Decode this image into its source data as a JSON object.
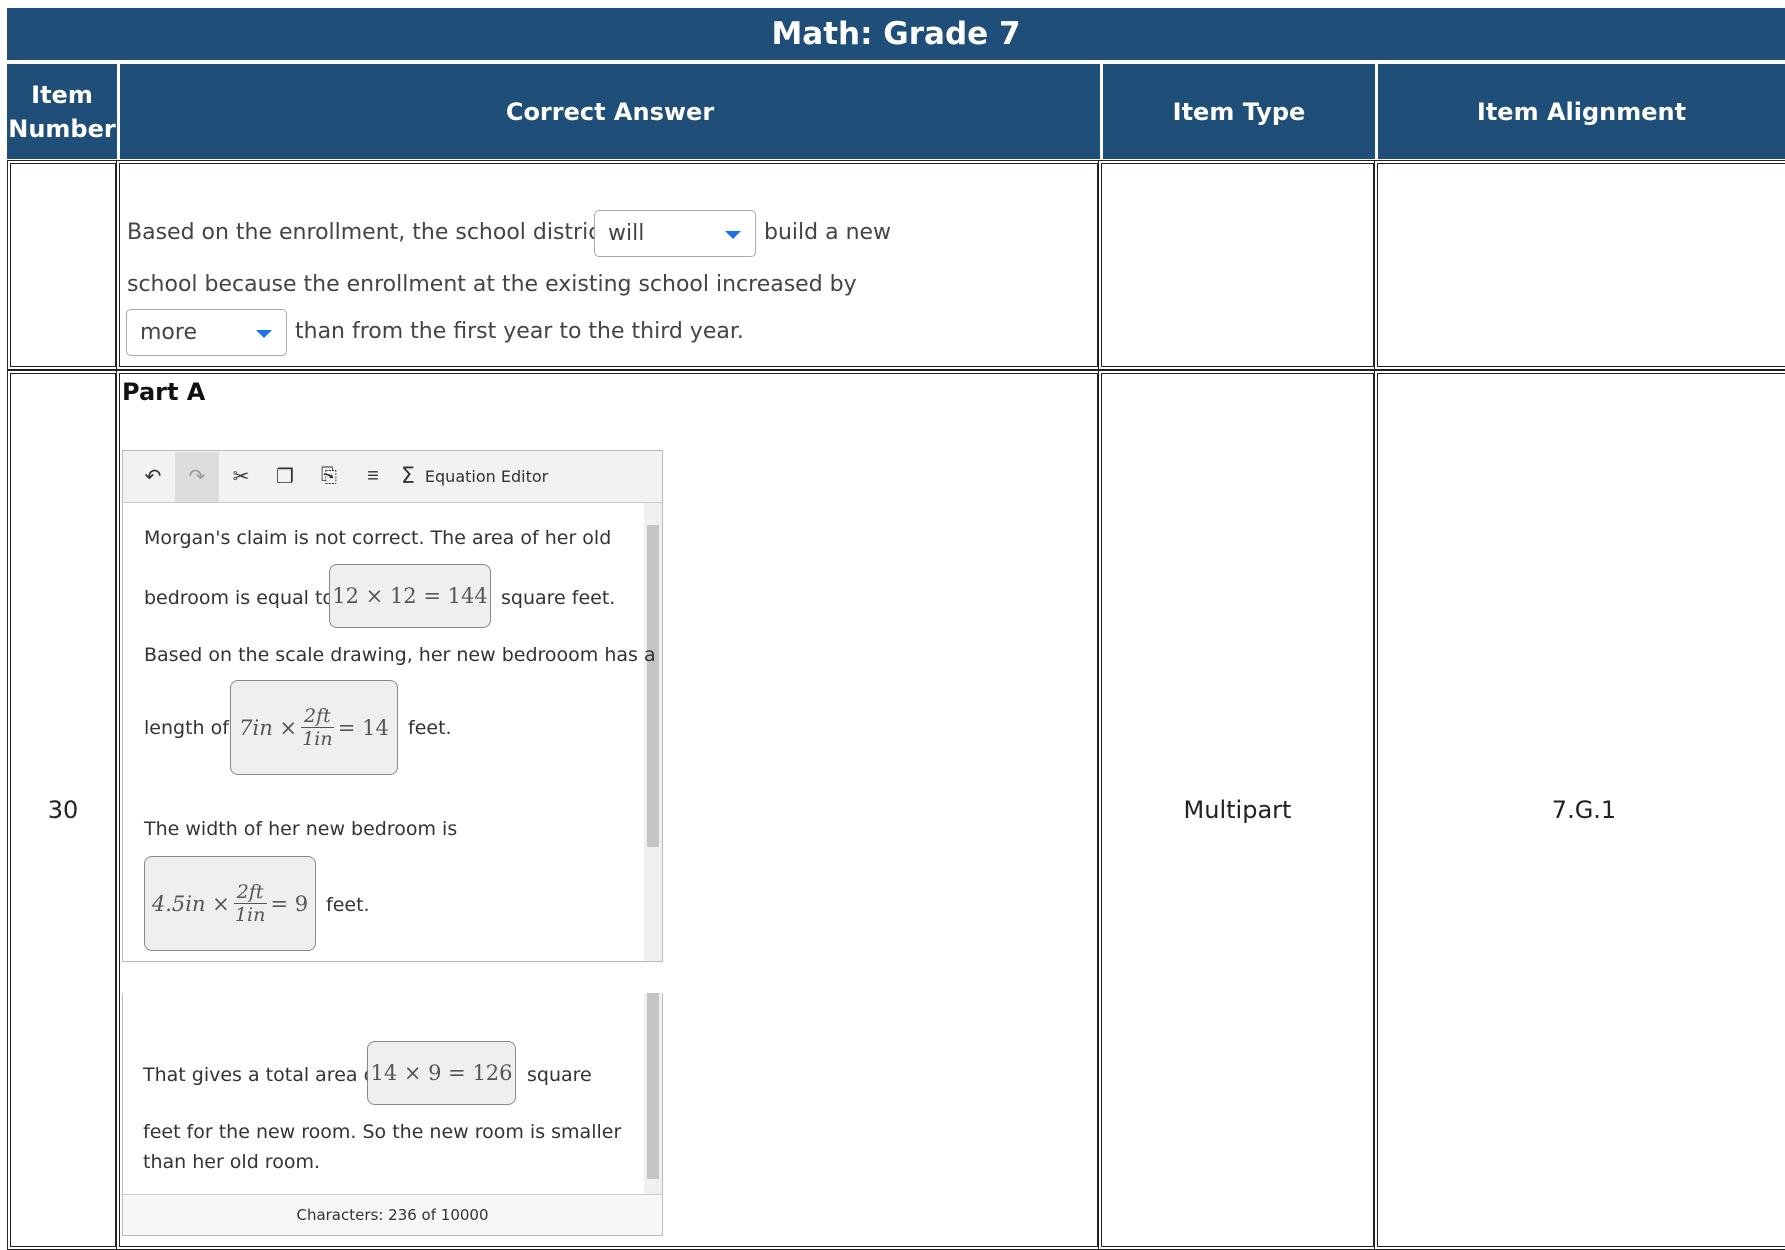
{
  "title": "Math: Grade 7",
  "headers": {
    "item_number": "Item Number",
    "correct_answer": "Correct Answer",
    "item_type": "Item Type",
    "item_alignment": "Item Alignment"
  },
  "row1": {
    "text_before_dropdown1": "Based on the enrollment, the school district",
    "dropdown1_value": "will",
    "text_after_dropdown1": "build a new",
    "text_line2": "school because the enrollment at the existing school increased by",
    "dropdown2_value": "more",
    "text_after_dropdown2": "than from the first year to the third year."
  },
  "row2": {
    "item_number": "30",
    "item_type": "Multipart",
    "item_alignment": "7.G.1",
    "part_label": "Part A",
    "editor": {
      "equation_editor_label": "Equation Editor",
      "line1": "Morgan's claim is not correct.  The area of her old",
      "line2_before": "bedroom is equal to",
      "math1": "12 × 12 = 144",
      "line2_after": "square feet.",
      "line3": "Based on the scale drawing, her new bedrooom has a",
      "line4_before": "length of",
      "math2_left": "7in ×",
      "math2_num": "2ft",
      "math2_den": "1in",
      "math2_right": "= 14",
      "line4_after": "feet.",
      "line5": "The width of her new bedroom is",
      "math3_left": "4.5in ×",
      "math3_num": "2ft",
      "math3_den": "1in",
      "math3_right": "= 9",
      "line6_after": "feet.",
      "line7_before": "That gives a total area of",
      "math4": "14 × 9 = 126",
      "line7_after": "square",
      "line8": "feet for the new room.  So the new room is smaller",
      "line9": "than her old room.",
      "char_count": "Characters: 236 of 10000"
    }
  },
  "colors": {
    "header_bg": "#1f4e79",
    "dropdown_caret": "#1a73e8"
  }
}
